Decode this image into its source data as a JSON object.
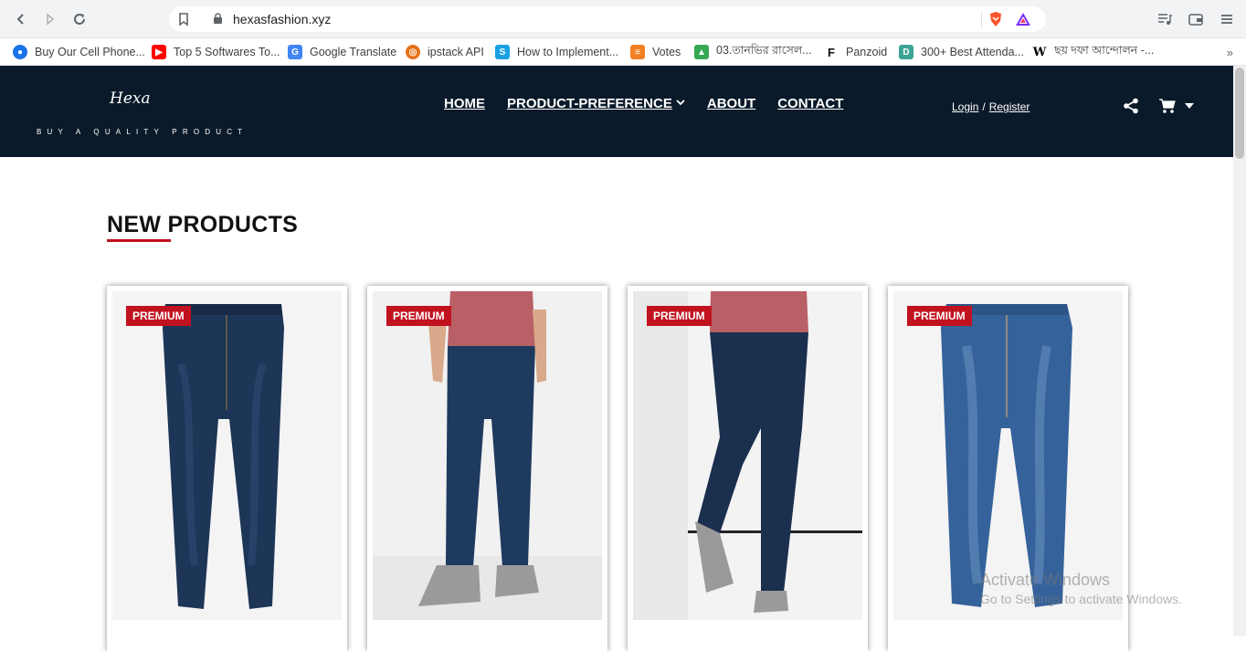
{
  "browser": {
    "url": "hexasfashion.xyz",
    "bookmarks": [
      {
        "label": "Buy Our Cell Phone...",
        "icon": "circle-lens-icon",
        "color": "#1a73e8"
      },
      {
        "label": "Top 5 Softwares To...",
        "icon": "youtube-icon",
        "color": "#ff0000"
      },
      {
        "label": "Google Translate",
        "icon": "translate-icon",
        "color": "#4285f4"
      },
      {
        "label": "ipstack API",
        "icon": "globe-icon",
        "color": "#e8711a"
      },
      {
        "label": "How to Implement...",
        "icon": "s-icon",
        "color": "#1ba1e2"
      },
      {
        "label": "Votes",
        "icon": "stackoverflow-icon",
        "color": "#f48024"
      },
      {
        "label": "03.তানভির রাসেল...",
        "icon": "drive-icon",
        "color": "#34a853"
      },
      {
        "label": "Panzoid",
        "icon": "panzoid-icon",
        "color": "#111111"
      },
      {
        "label": "300+ Best Attenda...",
        "icon": "d-icon",
        "color": "#3aa394"
      },
      {
        "label": "ছয় দফা আন্দোলন -...",
        "icon": "wikipedia-icon",
        "color": "#000000"
      }
    ],
    "more": "»"
  },
  "site": {
    "logo_script": "Hexa",
    "logo_tagline": "BUY A QUALITY PRODUCT",
    "nav": {
      "home": "HOME",
      "product_preference": "PRODUCT-PREFERENCE",
      "about": "ABOUT",
      "contact": "CONTACT"
    },
    "auth": {
      "login": "Login",
      "sep": "/",
      "register": "Register"
    },
    "colors": {
      "header_bg": "#0b1a2a",
      "accent": "#c1121f"
    }
  },
  "main": {
    "section_title": "NEW PRODUCTS",
    "products": [
      {
        "badge": "PREMIUM",
        "image": "dark-wash-jeans-flat"
      },
      {
        "badge": "PREMIUM",
        "image": "model-dark-jeans-front"
      },
      {
        "badge": "PREMIUM",
        "image": "model-dark-jeans-side"
      },
      {
        "badge": "PREMIUM",
        "image": "medium-wash-jeans-flat"
      }
    ]
  },
  "watermark": {
    "line1": "Activate Windows",
    "line2": "Go to Settings to activate Windows."
  }
}
